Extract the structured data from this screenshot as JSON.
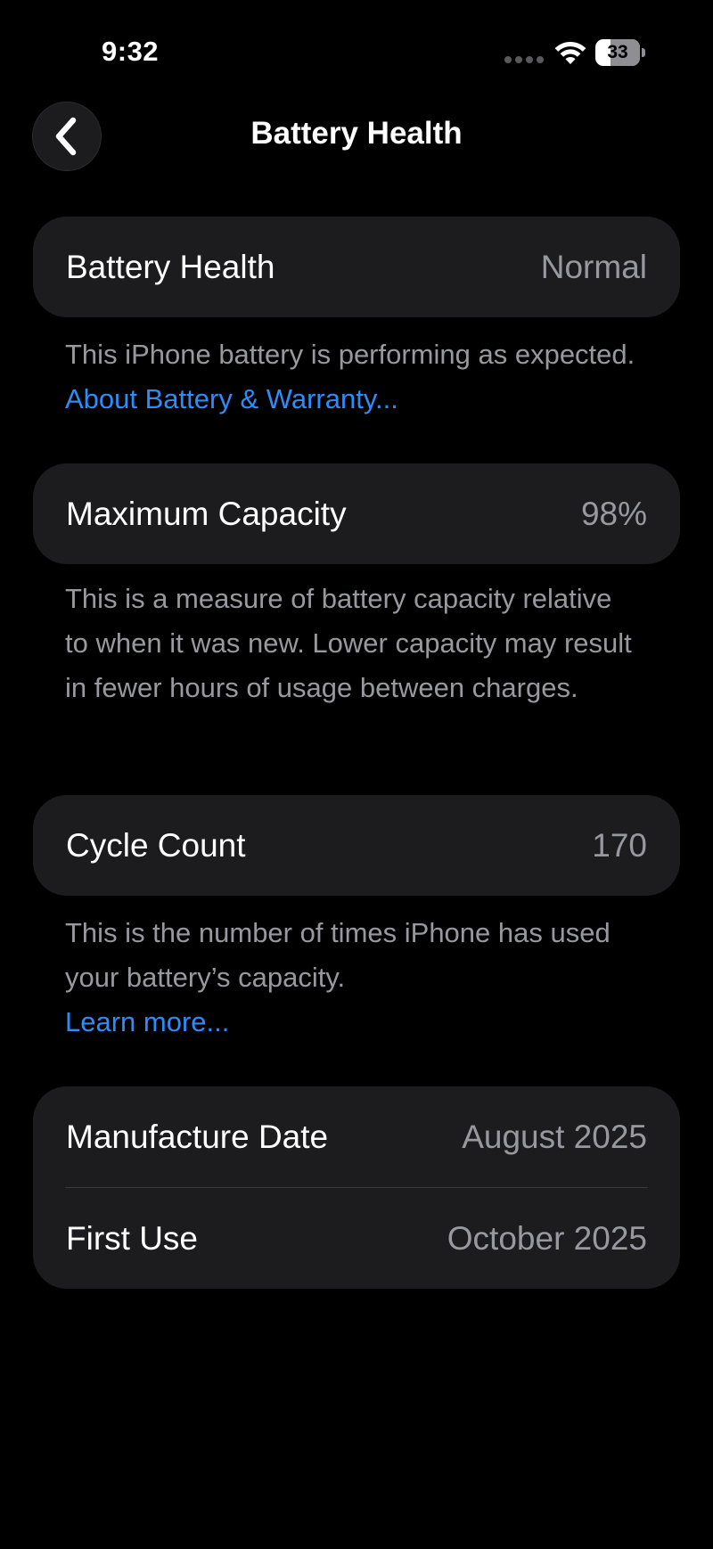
{
  "status_bar": {
    "time": "9:32",
    "battery_level": "33",
    "battery_fraction": 0.33
  },
  "nav": {
    "back_icon": "chevron-left-icon",
    "title": "Battery Health"
  },
  "battery_health": {
    "label": "Battery Health",
    "value": "Normal",
    "footnote_text": "This iPhone battery is performing as expected. ",
    "footnote_link": "About Battery & Warranty..."
  },
  "maximum_capacity": {
    "label": "Maximum Capacity",
    "value": "98%",
    "footnote_text": "This is a measure of battery capacity relative to when it was new. Lower capacity may result in fewer hours of usage between charges."
  },
  "cycle_count": {
    "label": "Cycle Count",
    "value": "170",
    "footnote_text": "This is the number of times iPhone has used your battery’s capacity.",
    "footnote_link": "Learn more..."
  },
  "dates": {
    "manufacture_label": "Manufacture Date",
    "manufacture_value": "August 2025",
    "first_use_label": "First Use",
    "first_use_value": "October 2025"
  },
  "colors": {
    "background": "#000000",
    "card": "#1c1c1e",
    "secondary_text": "#98989f",
    "link": "#2f8cf7"
  }
}
